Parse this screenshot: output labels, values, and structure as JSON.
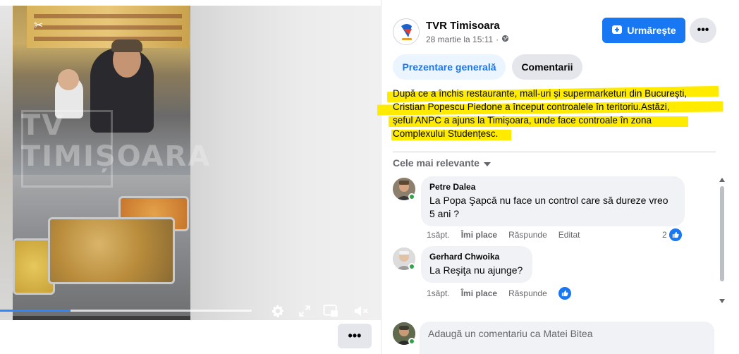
{
  "video": {
    "watermark_line1": "TV",
    "watermark_line2": "TIMIȘOARA",
    "progress_fraction": 0.28,
    "controls": [
      "gear-icon",
      "expand-icon",
      "pip-icon",
      "volume-muted-icon"
    ],
    "more_label": "•••"
  },
  "post": {
    "page_name": "TVR Timisoara",
    "date": "28 martie la 15:11",
    "date_separator": "·",
    "follow_label": "Urmărește",
    "more_label": "•••",
    "tabs": [
      {
        "label": "Prezentare generală"
      },
      {
        "label": "Comentarii"
      }
    ],
    "text_lines": [
      "După ce a închis restaurante, mall-uri și supermarketuri din București,",
      "Cristian Popescu Piedone a început controalele în teritoriu.Astăzi,",
      "șeful ANPC a ajuns la Timișoara, unde face controale în zona",
      "Complexului Studențesc."
    ]
  },
  "comments": {
    "sort_label": "Cele mai relevante",
    "items": [
      {
        "author": "Petre Dalea",
        "text_line1": "La Popa Şapcă nu face un control care să dureze vreo",
        "text_line2": "5 ani ?",
        "time": "1săpt.",
        "like": "Îmi place",
        "reply": "Răspunde",
        "edited": "Editat",
        "reactions": "2"
      },
      {
        "author": "Gerhard Chwoika",
        "text_line1": "La Reşiţa nu ajunge?",
        "time": "1săpt.",
        "like": "Îmi place",
        "reply": "Răspunde"
      }
    ],
    "input_placeholder": "Adaugă un comentariu ca Matei Bitea"
  },
  "colors": {
    "accent": "#1877f2",
    "highlight": "#ffeb00",
    "online": "#31a24c"
  }
}
